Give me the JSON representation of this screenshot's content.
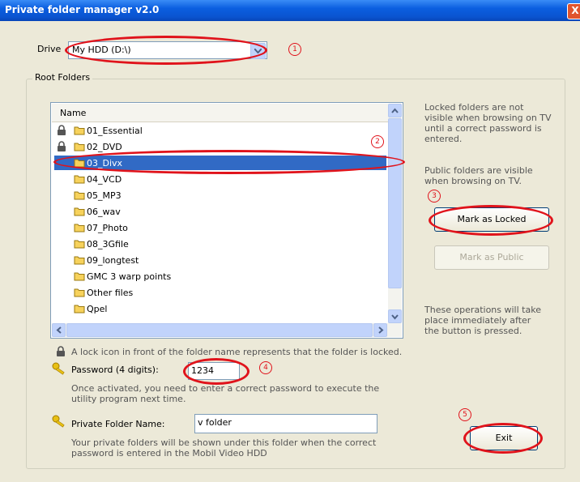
{
  "window": {
    "title": "Private folder manager v2.0",
    "close_glyph": "X"
  },
  "drive": {
    "label": "Drive",
    "value": "My HDD (D:\\)"
  },
  "root_folders": {
    "label": "Root Folders",
    "column_header": "Name",
    "items": [
      {
        "name": "01_Essential",
        "locked": true,
        "selected": false
      },
      {
        "name": "02_DVD",
        "locked": true,
        "selected": false
      },
      {
        "name": "03_Divx",
        "locked": false,
        "selected": true
      },
      {
        "name": "04_VCD",
        "locked": false,
        "selected": false
      },
      {
        "name": "05_MP3",
        "locked": false,
        "selected": false
      },
      {
        "name": "06_wav",
        "locked": false,
        "selected": false
      },
      {
        "name": "07_Photo",
        "locked": false,
        "selected": false
      },
      {
        "name": "08_3Gfile",
        "locked": false,
        "selected": false
      },
      {
        "name": "09_longtest",
        "locked": false,
        "selected": false
      },
      {
        "name": "GMC 3 warp points",
        "locked": false,
        "selected": false
      },
      {
        "name": "Other files",
        "locked": false,
        "selected": false
      },
      {
        "name": "Qpel",
        "locked": false,
        "selected": false
      }
    ]
  },
  "info": {
    "locked_note_lines": [
      "Locked folders are not",
      "visible when browsing on TV",
      "until a correct password is",
      "entered."
    ],
    "public_note_lines": [
      "Public folders are visible",
      "when browsing on TV."
    ],
    "operations_note_lines": [
      "These operations will take",
      "place immediately after",
      "the button is pressed."
    ]
  },
  "buttons": {
    "mark_locked": "Mark as Locked",
    "mark_public": "Mark as Public",
    "exit": "Exit"
  },
  "lock_legend": "A lock icon in front of the folder name represents that the folder is locked.",
  "password": {
    "label": "Password (4 digits):",
    "value": "1234",
    "note_lines": [
      "Once activated, you need to enter a correct password to execute the",
      "utility program next time."
    ]
  },
  "private_folder": {
    "label": "Private Folder Name:",
    "value": "v folder",
    "note_lines": [
      "Your private folders will be shown under this folder when the correct",
      "password is entered in the Mobil Video HDD"
    ]
  },
  "annotations": {
    "n1": "1",
    "n2": "2",
    "n3": "3",
    "n4": "4",
    "n5": "5"
  },
  "colors": {
    "annotation": "#e0131b",
    "selection": "#316ac5",
    "title_bar": "#0a54d0"
  }
}
